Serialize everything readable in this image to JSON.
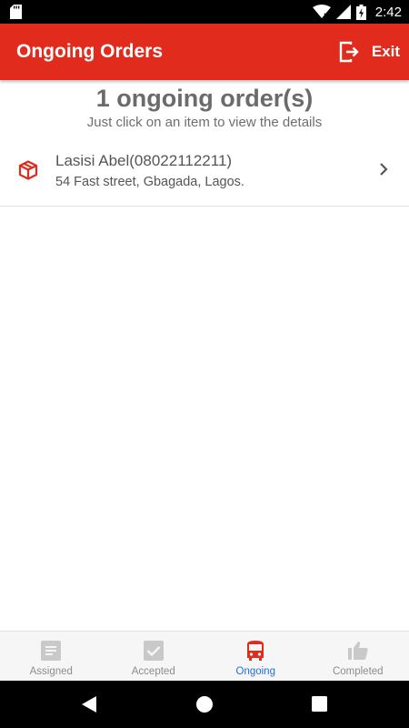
{
  "status_bar": {
    "time": "2:42",
    "icons": [
      "sd-card-icon",
      "wifi-icon",
      "signal-icon",
      "battery-icon"
    ]
  },
  "app_bar": {
    "title": "Ongoing Orders",
    "exit_label": "Exit",
    "color": "#e02b1d"
  },
  "summary": {
    "count_text": "1 ongoing order(s)",
    "hint": "Just click on an item to view the details"
  },
  "orders": [
    {
      "customer": "Lasisi Abel(08022112211)",
      "address": "54 Fast street, Gbagada, Lagos."
    }
  ],
  "bottom_nav": {
    "tabs": [
      {
        "label": "Assigned",
        "icon": "assigned-icon"
      },
      {
        "label": "Accepted",
        "icon": "accepted-icon"
      },
      {
        "label": "Ongoing",
        "icon": "bus-icon",
        "active": true
      },
      {
        "label": "Completed",
        "icon": "thumbs-up-icon"
      }
    ],
    "active_color": "#1e6fd9"
  }
}
